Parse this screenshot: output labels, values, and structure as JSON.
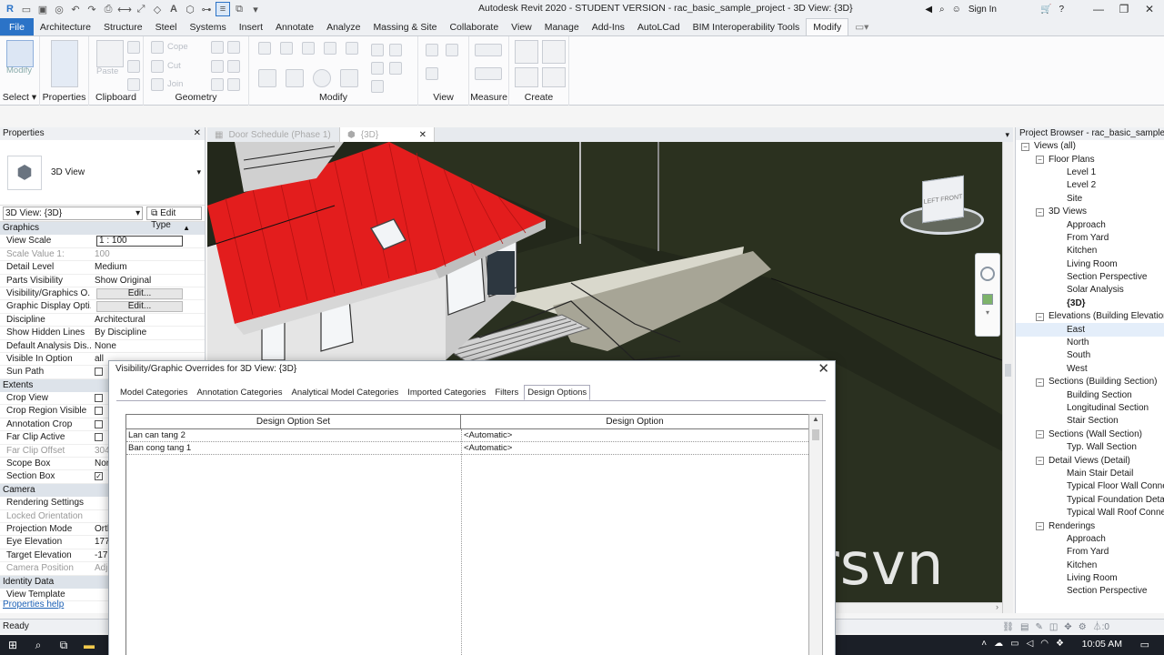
{
  "app": {
    "title": "Autodesk Revit 2020 - STUDENT VERSION - rac_basic_sample_project - 3D View: {3D}",
    "sign_in": "Sign In"
  },
  "ribbon": {
    "tabs": [
      "File",
      "Architecture",
      "Structure",
      "Steel",
      "Systems",
      "Insert",
      "Annotate",
      "Analyze",
      "Massing & Site",
      "Collaborate",
      "View",
      "Manage",
      "Add-Ins",
      "AutoLCad",
      "BIM Interoperability Tools",
      "Modify"
    ],
    "active_tab": "Modify",
    "select_label": "Select",
    "modify_btn": "Modify",
    "properties_label": "Properties",
    "paste_label": "Paste",
    "cope_label": "Cope",
    "cut_label": "Cut",
    "join_label": "Join",
    "groups": [
      "Clipboard",
      "Geometry",
      "Modify",
      "View",
      "Measure",
      "Create"
    ]
  },
  "properties": {
    "header": "Properties",
    "type_name": "3D View",
    "instance": "3D View: {3D}",
    "edit_type": "Edit Type",
    "sections": [
      {
        "name": "Graphics",
        "rows": [
          {
            "name": "View Scale",
            "value": "1 : 100",
            "grey": false,
            "kind": "box"
          },
          {
            "name": "Scale Value 1:",
            "value": "100",
            "grey": true,
            "kind": "text"
          },
          {
            "name": "Detail Level",
            "value": "Medium",
            "grey": false,
            "kind": "text"
          },
          {
            "name": "Parts Visibility",
            "value": "Show Original",
            "grey": false,
            "kind": "text"
          },
          {
            "name": "Visibility/Graphics O...",
            "value": "Edit...",
            "grey": false,
            "kind": "button"
          },
          {
            "name": "Graphic Display Opti...",
            "value": "Edit...",
            "grey": false,
            "kind": "button"
          },
          {
            "name": "Discipline",
            "value": "Architectural",
            "grey": false,
            "kind": "text"
          },
          {
            "name": "Show Hidden Lines",
            "value": "By Discipline",
            "grey": false,
            "kind": "text"
          },
          {
            "name": "Default Analysis Dis...",
            "value": "None",
            "grey": false,
            "kind": "text"
          },
          {
            "name": "Visible In Option",
            "value": "all",
            "grey": false,
            "kind": "text"
          },
          {
            "name": "Sun Path",
            "value": "",
            "grey": false,
            "kind": "check"
          }
        ]
      },
      {
        "name": "Extents",
        "rows": [
          {
            "name": "Crop View",
            "value": "",
            "grey": false,
            "kind": "check"
          },
          {
            "name": "Crop Region Visible",
            "value": "",
            "grey": false,
            "kind": "check"
          },
          {
            "name": "Annotation Crop",
            "value": "",
            "grey": false,
            "kind": "check"
          },
          {
            "name": "Far Clip Active",
            "value": "",
            "grey": false,
            "kind": "check"
          },
          {
            "name": "Far Clip Offset",
            "value": "304",
            "grey": true,
            "kind": "text"
          },
          {
            "name": "Scope Box",
            "value": "Nor",
            "grey": false,
            "kind": "text"
          },
          {
            "name": "Section Box",
            "value": "✓",
            "grey": false,
            "kind": "checked"
          }
        ]
      },
      {
        "name": "Camera",
        "rows": [
          {
            "name": "Rendering Settings",
            "value": "",
            "grey": false,
            "kind": "text"
          },
          {
            "name": "Locked Orientation",
            "value": "",
            "grey": true,
            "kind": "text"
          },
          {
            "name": "Projection Mode",
            "value": "Orth",
            "grey": false,
            "kind": "text"
          },
          {
            "name": "Eye Elevation",
            "value": "177",
            "grey": false,
            "kind": "text"
          },
          {
            "name": "Target Elevation",
            "value": "-17",
            "grey": false,
            "kind": "text"
          },
          {
            "name": "Camera Position",
            "value": "Adj",
            "grey": true,
            "kind": "text"
          }
        ]
      },
      {
        "name": "Identity Data",
        "rows": [
          {
            "name": "View Template",
            "value": "",
            "grey": false,
            "kind": "text"
          }
        ]
      }
    ],
    "help": "Properties help"
  },
  "view_tabs": [
    {
      "label": "Door Schedule (Phase 1)",
      "active": false
    },
    {
      "label": "{3D}",
      "active": true
    }
  ],
  "viewcube": {
    "left": "LEFT",
    "front": "FRONT"
  },
  "watermark": "ersvn",
  "browser": {
    "header": "Project Browser - rac_basic_sample_project",
    "tree": [
      {
        "label": "Views (all)",
        "level": 0,
        "toggle": "−"
      },
      {
        "label": "Floor Plans",
        "level": 1,
        "toggle": "−"
      },
      {
        "label": "Level 1",
        "level": 2,
        "toggle": ""
      },
      {
        "label": "Level 2",
        "level": 2,
        "toggle": ""
      },
      {
        "label": "Site",
        "level": 2,
        "toggle": ""
      },
      {
        "label": "3D Views",
        "level": 1,
        "toggle": "−"
      },
      {
        "label": "Approach",
        "level": 2,
        "toggle": ""
      },
      {
        "label": "From Yard",
        "level": 2,
        "toggle": ""
      },
      {
        "label": "Kitchen",
        "level": 2,
        "toggle": ""
      },
      {
        "label": "Living Room",
        "level": 2,
        "toggle": ""
      },
      {
        "label": "Section Perspective",
        "level": 2,
        "toggle": ""
      },
      {
        "label": "Solar Analysis",
        "level": 2,
        "toggle": ""
      },
      {
        "label": "{3D}",
        "level": 2,
        "toggle": "",
        "bold": true
      },
      {
        "label": "Elevations (Building Elevation)",
        "level": 1,
        "toggle": "−"
      },
      {
        "label": "East",
        "level": 2,
        "toggle": "",
        "selected": true
      },
      {
        "label": "North",
        "level": 2,
        "toggle": ""
      },
      {
        "label": "South",
        "level": 2,
        "toggle": ""
      },
      {
        "label": "West",
        "level": 2,
        "toggle": ""
      },
      {
        "label": "Sections (Building Section)",
        "level": 1,
        "toggle": "−"
      },
      {
        "label": "Building Section",
        "level": 2,
        "toggle": ""
      },
      {
        "label": "Longitudinal Section",
        "level": 2,
        "toggle": ""
      },
      {
        "label": "Stair Section",
        "level": 2,
        "toggle": ""
      },
      {
        "label": "Sections (Wall Section)",
        "level": 1,
        "toggle": "−"
      },
      {
        "label": "Typ. Wall Section",
        "level": 2,
        "toggle": ""
      },
      {
        "label": "Detail Views (Detail)",
        "level": 1,
        "toggle": "−"
      },
      {
        "label": "Main Stair Detail",
        "level": 2,
        "toggle": ""
      },
      {
        "label": "Typical Floor Wall Connection",
        "level": 2,
        "toggle": ""
      },
      {
        "label": "Typical Foundation Detail",
        "level": 2,
        "toggle": ""
      },
      {
        "label": "Typical Wall Roof Connection",
        "level": 2,
        "toggle": ""
      },
      {
        "label": "Renderings",
        "level": 1,
        "toggle": "−"
      },
      {
        "label": "Approach",
        "level": 2,
        "toggle": ""
      },
      {
        "label": "From Yard",
        "level": 2,
        "toggle": ""
      },
      {
        "label": "Kitchen",
        "level": 2,
        "toggle": ""
      },
      {
        "label": "Living Room",
        "level": 2,
        "toggle": ""
      },
      {
        "label": "Section Perspective",
        "level": 2,
        "toggle": ""
      }
    ]
  },
  "status": {
    "text": "Ready",
    "filter": ":0"
  },
  "taskbar": {
    "time": "10:05 AM"
  },
  "dialog": {
    "title": "Visibility/Graphic Overrides for 3D View: {3D}",
    "tabs": [
      "Model Categories",
      "Annotation Categories",
      "Analytical Model Categories",
      "Imported Categories",
      "Filters",
      "Design Options"
    ],
    "active_tab": "Design Options",
    "columns": [
      "Design Option Set",
      "Design Option"
    ],
    "rows": [
      {
        "set": "Lan can tang 2",
        "option": "<Automatic>"
      },
      {
        "set": "Ban cong tang 1",
        "option": "<Automatic>"
      }
    ]
  }
}
